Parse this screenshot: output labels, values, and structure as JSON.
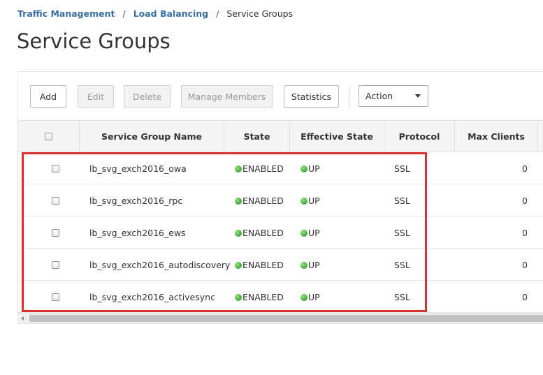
{
  "breadcrumb": {
    "items": [
      "Traffic Management",
      "Load Balancing"
    ],
    "current": "Service Groups",
    "separator": "/"
  },
  "page": {
    "title": "Service Groups"
  },
  "toolbar": {
    "add": "Add",
    "edit": "Edit",
    "delete": "Delete",
    "manage_members": "Manage Members",
    "statistics": "Statistics",
    "action": "Action"
  },
  "table": {
    "columns": [
      "Service Group Name",
      "State",
      "Effective State",
      "Protocol",
      "Max Clients"
    ],
    "rows": [
      {
        "name": "lb_svg_exch2016_owa",
        "state": "ENABLED",
        "effective_state": "UP",
        "protocol": "SSL",
        "max_clients": "0"
      },
      {
        "name": "lb_svg_exch2016_rpc",
        "state": "ENABLED",
        "effective_state": "UP",
        "protocol": "SSL",
        "max_clients": "0"
      },
      {
        "name": "lb_svg_exch2016_ews",
        "state": "ENABLED",
        "effective_state": "UP",
        "protocol": "SSL",
        "max_clients": "0"
      },
      {
        "name": "lb_svg_exch2016_autodiscovery",
        "state": "ENABLED",
        "effective_state": "UP",
        "protocol": "SSL",
        "max_clients": "0"
      },
      {
        "name": "lb_svg_exch2016_activesync",
        "state": "ENABLED",
        "effective_state": "UP",
        "protocol": "SSL",
        "max_clients": "0"
      }
    ]
  },
  "colors": {
    "link": "#3a6ea5",
    "status_green": "#3aa83a",
    "highlight_red": "#d9302a"
  },
  "icons": {
    "status": "green-dot-icon",
    "dropdown": "chevron-down-icon"
  }
}
